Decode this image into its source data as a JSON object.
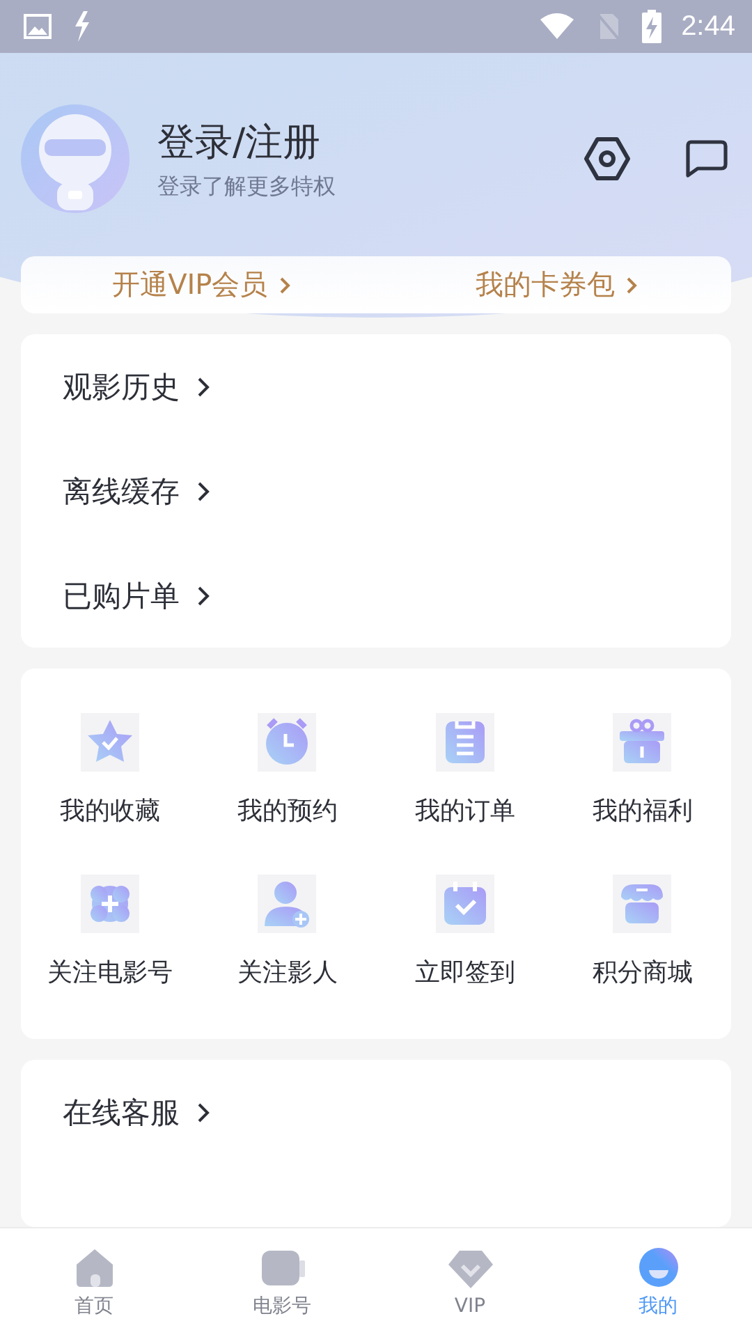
{
  "status_bar": {
    "time": "2:44"
  },
  "profile": {
    "title": "登录/注册",
    "subtitle": "登录了解更多特权"
  },
  "vip_card": {
    "links": [
      {
        "label": "开通VIP会员"
      },
      {
        "label": "我的卡券包"
      }
    ]
  },
  "history_list": [
    {
      "label": "观影历史"
    },
    {
      "label": "离线缓存"
    },
    {
      "label": "已购片单"
    }
  ],
  "shortcuts": [
    {
      "kind": "star",
      "label": "我的收藏"
    },
    {
      "kind": "clock",
      "label": "我的预约"
    },
    {
      "kind": "clipboard",
      "label": "我的订单"
    },
    {
      "kind": "gift",
      "label": "我的福利"
    },
    {
      "kind": "badge",
      "label": "关注电影号"
    },
    {
      "kind": "person",
      "label": "关注影人"
    },
    {
      "kind": "calendar",
      "label": "立即签到"
    },
    {
      "kind": "store",
      "label": "积分商城"
    }
  ],
  "service_list": [
    {
      "label": "在线客服"
    }
  ],
  "tab_bar": [
    {
      "kind": "home",
      "label": "首页",
      "selected": false
    },
    {
      "kind": "video",
      "label": "电影号",
      "selected": false
    },
    {
      "kind": "diamond",
      "label": "VIP",
      "selected": false
    },
    {
      "kind": "me",
      "label": "我的",
      "selected": true
    }
  ]
}
